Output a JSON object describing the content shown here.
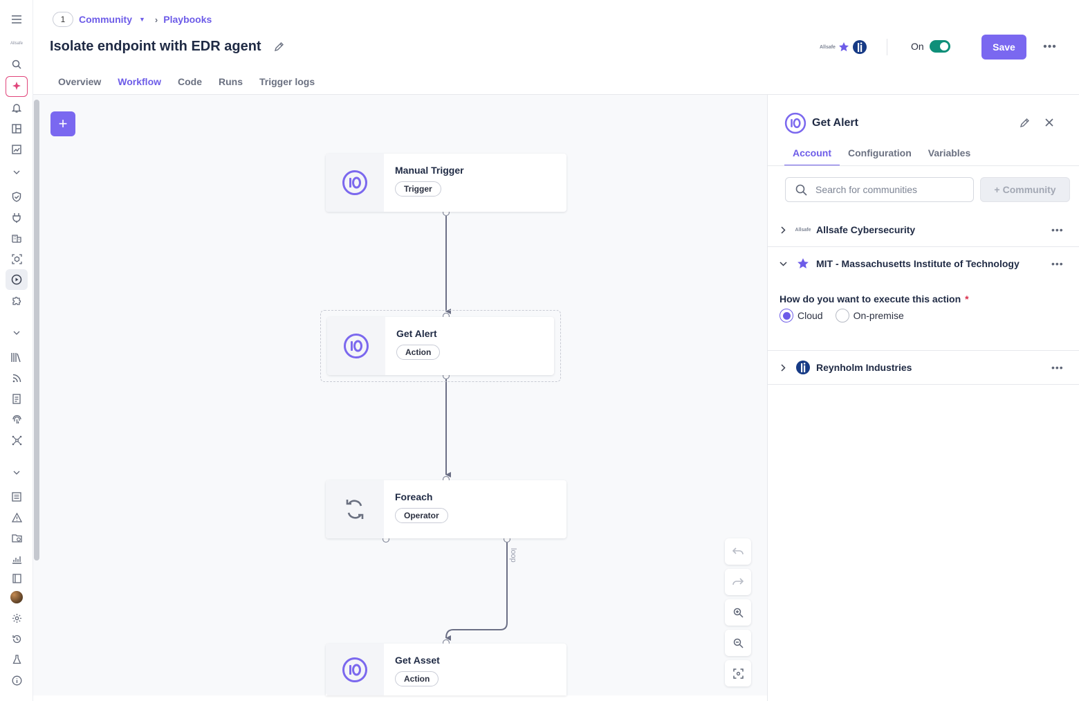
{
  "breadcrumb": {
    "community_count": "1",
    "community_label": "Community",
    "playbooks_label": "Playbooks"
  },
  "page": {
    "title": "Isolate endpoint with EDR agent"
  },
  "header": {
    "toggle_label": "On",
    "toggle_state": "on",
    "save_label": "Save",
    "more_label": "•••"
  },
  "tabs": [
    "Overview",
    "Workflow",
    "Code",
    "Runs",
    "Trigger logs"
  ],
  "active_tab": "Workflow",
  "workflow": {
    "nodes": [
      {
        "name": "Manual Trigger",
        "tag": "Trigger",
        "icon": "io-logo-icon"
      },
      {
        "name": "Get Alert",
        "tag": "Action",
        "icon": "io-logo-icon",
        "selected": true
      },
      {
        "name": "Foreach",
        "tag": "Operator",
        "icon": "loop-icon"
      },
      {
        "name": "Get Asset",
        "tag": "Action",
        "icon": "io-logo-icon"
      }
    ],
    "loop_label": "loop"
  },
  "panel": {
    "title": "Get Alert",
    "tabs": [
      "Account",
      "Configuration",
      "Variables"
    ],
    "active_tab": "Account",
    "search_placeholder": "Search for communities",
    "community_button": "Community",
    "accounts": [
      {
        "name": "Allsafe Cybersecurity",
        "logo_text": "Allsafe",
        "expanded": false
      },
      {
        "name": "MIT - Massachusetts Institute of Technology",
        "logo": "star-icon",
        "expanded": true
      },
      {
        "name": "Reynholm Industries",
        "logo": "reynholm-logo-icon",
        "expanded": false
      }
    ],
    "question": "How do you want to execute this action",
    "required_mark": "*",
    "options": [
      "Cloud",
      "On-premise"
    ],
    "selected_option": "Cloud"
  },
  "colors": {
    "accent": "#6d5ce8",
    "save": "#7a68f0",
    "toggle_on": "#0f8f79",
    "required": "#d92d4b"
  }
}
